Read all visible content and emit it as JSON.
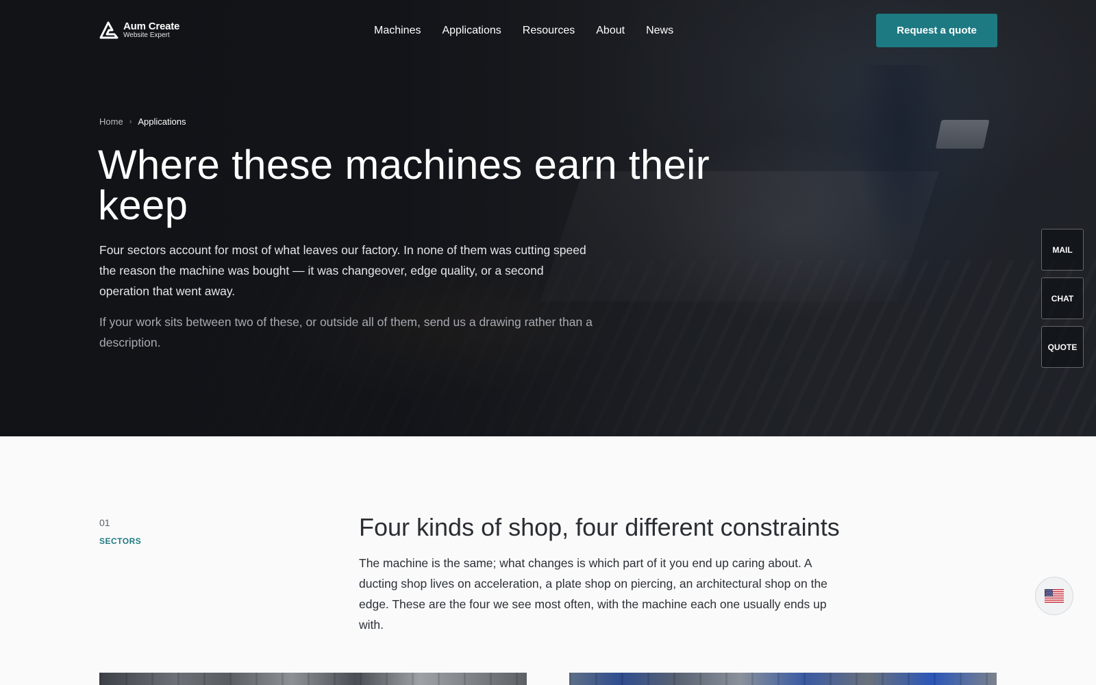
{
  "brand": {
    "name": "Aum Create",
    "tagline": "Website Expert"
  },
  "nav": {
    "items": [
      {
        "label": "Machines"
      },
      {
        "label": "Applications"
      },
      {
        "label": "Resources"
      },
      {
        "label": "About"
      },
      {
        "label": "News"
      }
    ],
    "cta_label": "Request a quote"
  },
  "breadcrumb": {
    "home": "Home",
    "separator": "›",
    "current": "Applications"
  },
  "hero": {
    "title": "Where these machines earn their keep",
    "lead": "Four sectors account for most of what leaves our factory. In none of them was cutting speed the reason the machine was bought — it was changeover, edge quality, or a second operation that went away.",
    "note": "If your work sits between two of these, or outside all of them, send us a drawing rather than a description."
  },
  "side_rail": {
    "mail": "MAIL",
    "chat": "CHAT",
    "quote": "QUOTE"
  },
  "section": {
    "number": "01",
    "tag": "SECTORS",
    "title": "Four kinds of shop, four different constraints",
    "body": "The machine is the same; what changes is which part of it you end up caring about. A ducting shop lives on acceleration, a plate shop on piercing, an architectural shop on the edge. These are the four we see most often, with the machine each one usually ends up with."
  },
  "language": {
    "icon": "us-flag-icon"
  },
  "colors": {
    "accent": "#1e7a82",
    "hero_bg": "#16181d",
    "page_bg": "#fafafa"
  }
}
